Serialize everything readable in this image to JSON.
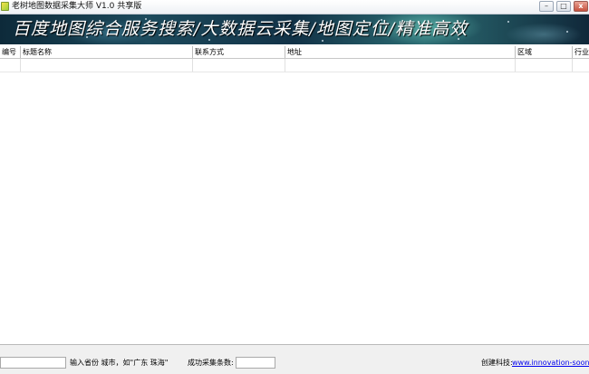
{
  "window": {
    "title": "老树地图数据采集大师  V1.0  共享版",
    "minimize": "–",
    "maximize": "□",
    "close": "x"
  },
  "banner": {
    "text": "百度地图综合服务搜索/大数据云采集/地图定位/精准高效"
  },
  "table": {
    "columns": [
      "编号",
      "标题名称",
      "联系方式",
      "地址",
      "区域",
      "行业"
    ]
  },
  "footer": {
    "region_input": "",
    "region_hint": "输入省份 城市，如\"广东 珠海\"",
    "count_label": "成功采集条数:",
    "count_value": "",
    "credit_label": "创建科技:",
    "credit_link": "www.innovation-soon.com"
  },
  "colors": {
    "banner_bg": "#1d4a5c",
    "link": "#0000ee"
  }
}
